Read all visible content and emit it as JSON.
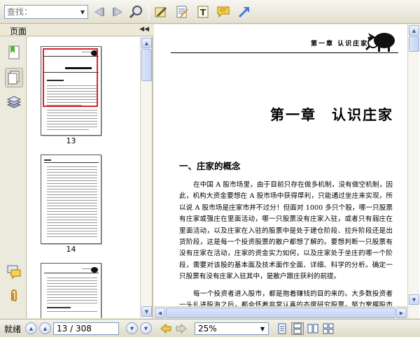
{
  "toolbar": {
    "search_placeholder": "查找：",
    "icons": [
      "search-dropdown-icon",
      "prev-result-icon",
      "next-result-icon",
      "search-zoom-icon",
      "highlight-pencil-icon",
      "note-pad-icon",
      "text-tool-icon",
      "comment-icon",
      "arrow-tool-icon"
    ]
  },
  "left_panel": {
    "title": "页面",
    "collapse_glyph": "◀◀",
    "side_icons": [
      "bookmark-icon",
      "pages-icon",
      "layers-icon",
      "comments-icon",
      "attachment-icon"
    ],
    "thumbnails": [
      {
        "label": "13",
        "selected": true
      },
      {
        "label": "14",
        "selected": false
      },
      {
        "label": "",
        "selected": false
      }
    ]
  },
  "document": {
    "header": "第一章  认识庄家",
    "chapter_title": "第一章　认识庄家",
    "section_title": "一、庄家的概念",
    "paragraphs": [
      "在中国 A 股市场里，由于目前只存在做多机制，没有做空机制，因此，机构大资金要想在 A 股市场中获得厚利，只能通过坐庄来实现，所以说 A 股市场是庄家市并不过分！但面对 1000 多只个股，哪一只股票有庄家或强庄在里面活动，哪一只股票没有庄家入驻，或者只有弱庄在里面活动，以及庄家在入驻的股票中是处于建仓阶段、拉升阶段还是出货阶段，这是每一个投资股票的散户都想了解的。要想判断一只股票有没有庄家在活动，庄家的资金实力如何，以及庄家处于坐庄的哪一个阶段，需要对该股的基本面及技术面作全面、详细、科学的分析。确定一只股票有没有庄家入驻其中，是散户跟庄获利的前提。",
      "每一个投资者进入股市，都是抱着赚钱的目的来的。大多数投资者一头扎进股海之后，都会怀着非常认真的态度研究股票，努力掌握股市基本知识和技术，但最终的结果还是大多数人亏损。中国的证券市场目前是一个投机市"
    ]
  },
  "statusbar": {
    "status": "就绪",
    "page_display": "13 / 308",
    "zoom": "25%"
  }
}
